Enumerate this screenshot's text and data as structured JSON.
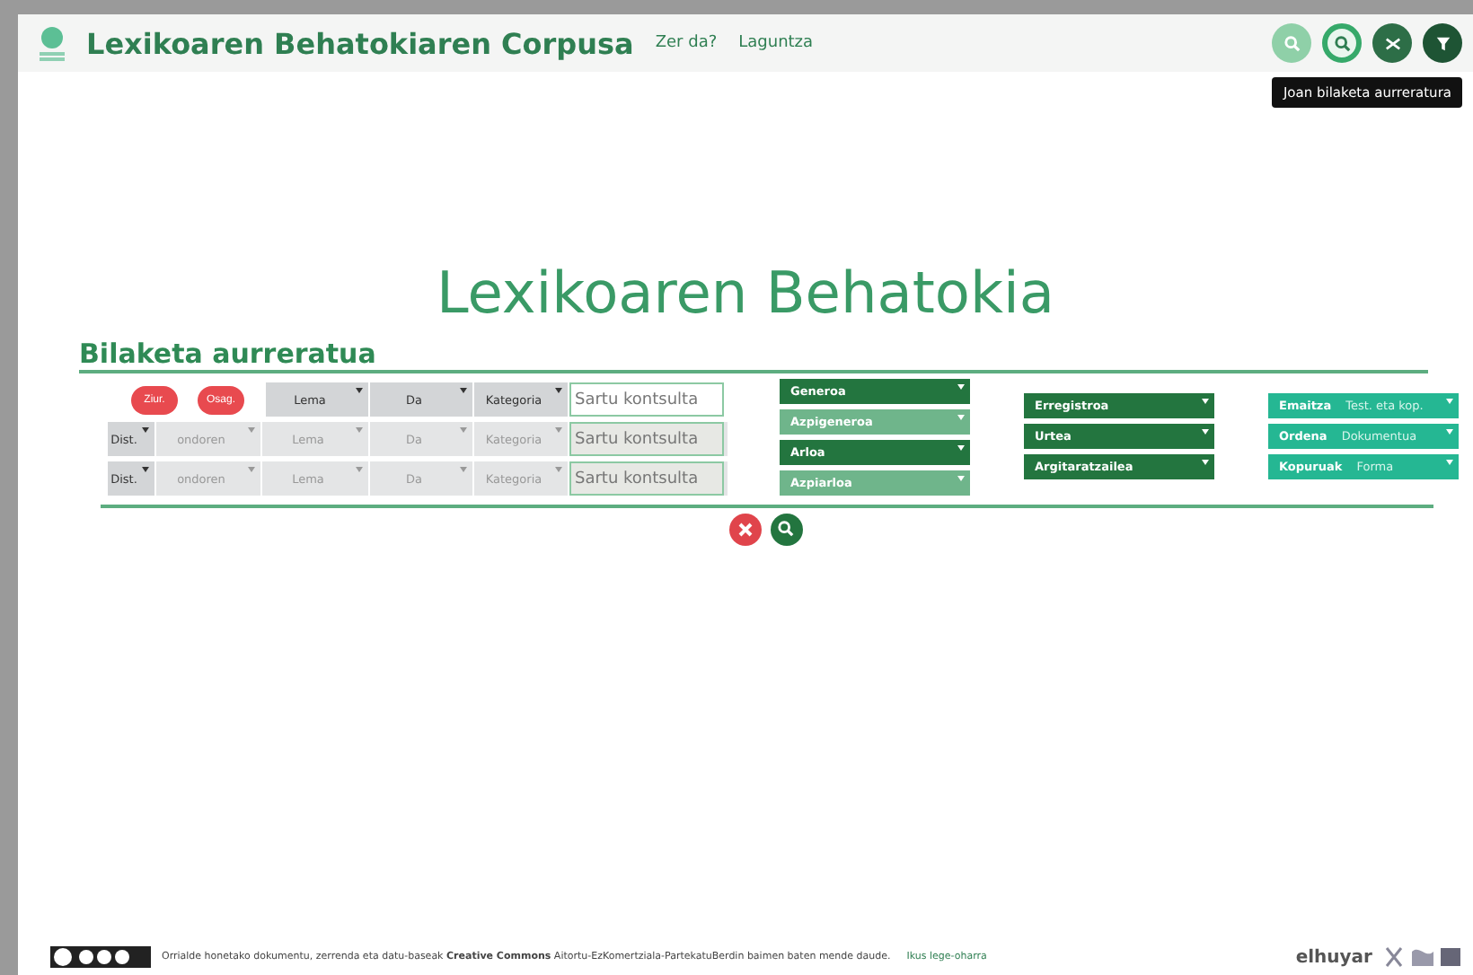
{
  "header": {
    "title": "Lexikoaren Behatokiaren Corpusa",
    "links": [
      "Zer da?",
      "Laguntza"
    ],
    "tools": [
      {
        "kind": "search",
        "selected": false
      },
      {
        "kind": "advanced-search",
        "selected": true
      },
      {
        "kind": "shuffle",
        "selected": false
      },
      {
        "kind": "filter",
        "selected": false
      }
    ],
    "tooltip": "Joan bilaketa aurreratura"
  },
  "main_title": "Lexikoaren Behatokia",
  "section_title": "Bilaketa aurreratua",
  "query_rows": [
    {
      "kind": "first",
      "buttons": [
        "Ziur.",
        "Osag."
      ],
      "selects": [
        "Lema",
        "Da",
        "Kategoria"
      ],
      "placeholder": "Sartu kontsulta",
      "disabled": false
    },
    {
      "kind": "next",
      "distance": "Dist.",
      "selects": [
        "ondoren",
        "Lema",
        "Da",
        "Kategoria"
      ],
      "placeholder": "Sartu kontsulta",
      "disabled": true
    },
    {
      "kind": "next",
      "distance": "Dist.",
      "selects": [
        "ondoren",
        "Lema",
        "Da",
        "Kategoria"
      ],
      "placeholder": "Sartu kontsulta",
      "disabled": true
    }
  ],
  "filter_groups": [
    [
      {
        "label": "Generoa",
        "disabled": false
      },
      {
        "label": "Azpigeneroa",
        "disabled": true
      },
      {
        "label": "Arloa",
        "disabled": false
      },
      {
        "label": "Azpiarloa",
        "disabled": true
      }
    ],
    [
      {
        "label": "Erregistroa",
        "disabled": false
      },
      {
        "label": "Urtea",
        "disabled": false
      },
      {
        "label": "Argitaratzailea",
        "disabled": false
      }
    ]
  ],
  "options": [
    {
      "label": "Emaitza",
      "value": "Test. eta kop."
    },
    {
      "label": "Ordena",
      "value": "Dokumentua"
    },
    {
      "label": "Kopuruak",
      "value": "Forma"
    }
  ],
  "actions": [
    {
      "kind": "clear"
    },
    {
      "kind": "search"
    }
  ],
  "footer": {
    "license": "Orrialde honetako dokumentu, zerrenda eta datu-baseak **Creative Commons** Aitortu-EzKomertziala-PartekatuBerdin baimen baten mende daude.",
    "link": "Ikus lege-oharra",
    "brand": "elhuyar"
  }
}
